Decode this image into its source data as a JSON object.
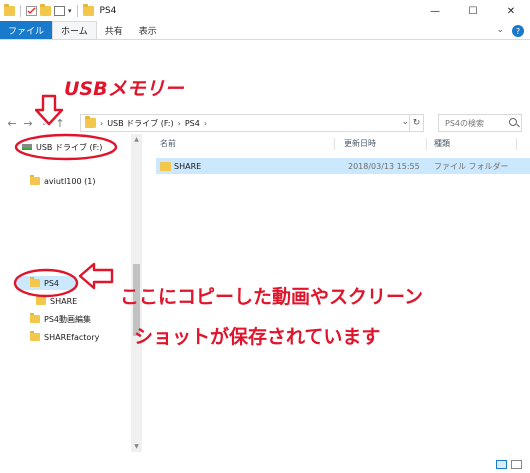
{
  "window": {
    "title": "PS4",
    "minimize": "—",
    "maximize": "☐",
    "close": "✕"
  },
  "ribbon": {
    "tabs": [
      "ファイル",
      "ホーム",
      "共有",
      "表示"
    ],
    "help": "?"
  },
  "address": {
    "crumbs": [
      "USB ドライブ (F:)",
      "PS4"
    ],
    "search_placeholder": "PS4の検索"
  },
  "nav_pane": {
    "items": [
      {
        "label": "USB ドライブ (F:)",
        "type": "drive"
      },
      {
        "label": "aviutl100 (1)",
        "type": "folder"
      },
      {
        "label": "PS4",
        "type": "folder",
        "selected": true
      },
      {
        "label": "SHARE",
        "type": "folder"
      },
      {
        "label": "PS4動画編集",
        "type": "folder"
      },
      {
        "label": "SHAREfactory",
        "type": "folder"
      }
    ]
  },
  "columns": {
    "name": "名前",
    "date": "更新日時",
    "type": "種類"
  },
  "files": [
    {
      "name": "SHARE",
      "date": "2018/03/13 15:55",
      "type": "ファイル フォルダー"
    }
  ],
  "annotations": {
    "usb_label": "USBメモリー",
    "note_line1": "ここにコピーした動画やスクリーン",
    "note_line2": "ショットが保存されています",
    "color": "#e0142b"
  }
}
